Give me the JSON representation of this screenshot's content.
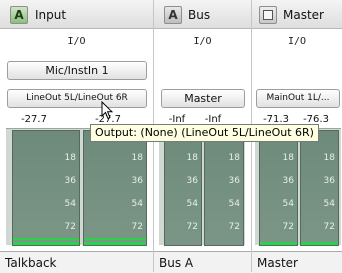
{
  "strips": [
    {
      "badge": "A",
      "name": "Input",
      "io_label": "I/O",
      "input_button": "Mic/InstIn 1",
      "output_button": "LineOut 5L/LineOut 6R",
      "peaks": [
        "-27.7",
        "-27.7"
      ],
      "scale": [
        "18",
        "36",
        "54",
        "72"
      ],
      "footer": "Talkback"
    },
    {
      "badge": "A",
      "name": "Bus",
      "io_label": "I/O",
      "output_button": "Master",
      "peaks": [
        "-Inf",
        "-Inf"
      ],
      "scale": [
        "18",
        "36",
        "54",
        "72"
      ],
      "footer": "Bus A"
    },
    {
      "badge": "",
      "name": "Master",
      "io_label": "I/O",
      "output_button": "MainOut 1L/...",
      "peaks": [
        "-71.3",
        "-76.3"
      ],
      "scale": [
        "18",
        "36",
        "54",
        "72"
      ],
      "footer": "Master"
    }
  ],
  "tooltip": "Output: (None) (LineOut 5L/LineOut 6R)"
}
